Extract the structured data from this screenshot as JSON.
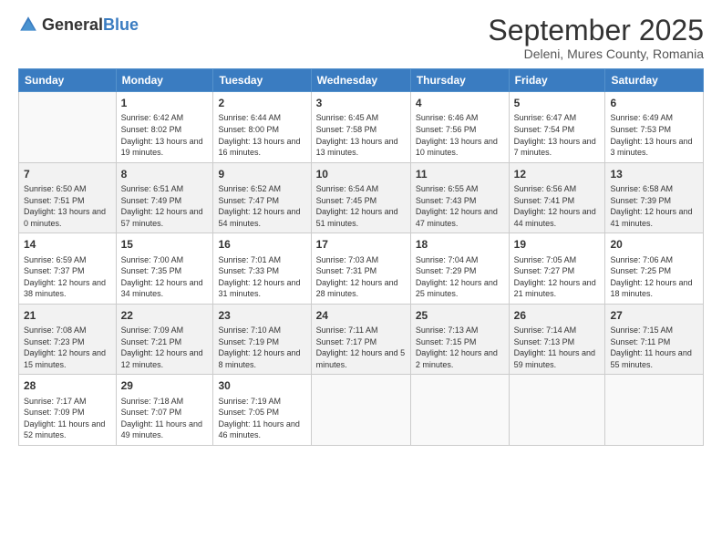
{
  "logo": {
    "general": "General",
    "blue": "Blue"
  },
  "title": "September 2025",
  "subtitle": "Deleni, Mures County, Romania",
  "days_header": [
    "Sunday",
    "Monday",
    "Tuesday",
    "Wednesday",
    "Thursday",
    "Friday",
    "Saturday"
  ],
  "weeks": [
    [
      {
        "day": "",
        "sunrise": "",
        "sunset": "",
        "daylight": ""
      },
      {
        "day": "1",
        "sunrise": "Sunrise: 6:42 AM",
        "sunset": "Sunset: 8:02 PM",
        "daylight": "Daylight: 13 hours and 19 minutes."
      },
      {
        "day": "2",
        "sunrise": "Sunrise: 6:44 AM",
        "sunset": "Sunset: 8:00 PM",
        "daylight": "Daylight: 13 hours and 16 minutes."
      },
      {
        "day": "3",
        "sunrise": "Sunrise: 6:45 AM",
        "sunset": "Sunset: 7:58 PM",
        "daylight": "Daylight: 13 hours and 13 minutes."
      },
      {
        "day": "4",
        "sunrise": "Sunrise: 6:46 AM",
        "sunset": "Sunset: 7:56 PM",
        "daylight": "Daylight: 13 hours and 10 minutes."
      },
      {
        "day": "5",
        "sunrise": "Sunrise: 6:47 AM",
        "sunset": "Sunset: 7:54 PM",
        "daylight": "Daylight: 13 hours and 7 minutes."
      },
      {
        "day": "6",
        "sunrise": "Sunrise: 6:49 AM",
        "sunset": "Sunset: 7:53 PM",
        "daylight": "Daylight: 13 hours and 3 minutes."
      }
    ],
    [
      {
        "day": "7",
        "sunrise": "Sunrise: 6:50 AM",
        "sunset": "Sunset: 7:51 PM",
        "daylight": "Daylight: 13 hours and 0 minutes."
      },
      {
        "day": "8",
        "sunrise": "Sunrise: 6:51 AM",
        "sunset": "Sunset: 7:49 PM",
        "daylight": "Daylight: 12 hours and 57 minutes."
      },
      {
        "day": "9",
        "sunrise": "Sunrise: 6:52 AM",
        "sunset": "Sunset: 7:47 PM",
        "daylight": "Daylight: 12 hours and 54 minutes."
      },
      {
        "day": "10",
        "sunrise": "Sunrise: 6:54 AM",
        "sunset": "Sunset: 7:45 PM",
        "daylight": "Daylight: 12 hours and 51 minutes."
      },
      {
        "day": "11",
        "sunrise": "Sunrise: 6:55 AM",
        "sunset": "Sunset: 7:43 PM",
        "daylight": "Daylight: 12 hours and 47 minutes."
      },
      {
        "day": "12",
        "sunrise": "Sunrise: 6:56 AM",
        "sunset": "Sunset: 7:41 PM",
        "daylight": "Daylight: 12 hours and 44 minutes."
      },
      {
        "day": "13",
        "sunrise": "Sunrise: 6:58 AM",
        "sunset": "Sunset: 7:39 PM",
        "daylight": "Daylight: 12 hours and 41 minutes."
      }
    ],
    [
      {
        "day": "14",
        "sunrise": "Sunrise: 6:59 AM",
        "sunset": "Sunset: 7:37 PM",
        "daylight": "Daylight: 12 hours and 38 minutes."
      },
      {
        "day": "15",
        "sunrise": "Sunrise: 7:00 AM",
        "sunset": "Sunset: 7:35 PM",
        "daylight": "Daylight: 12 hours and 34 minutes."
      },
      {
        "day": "16",
        "sunrise": "Sunrise: 7:01 AM",
        "sunset": "Sunset: 7:33 PM",
        "daylight": "Daylight: 12 hours and 31 minutes."
      },
      {
        "day": "17",
        "sunrise": "Sunrise: 7:03 AM",
        "sunset": "Sunset: 7:31 PM",
        "daylight": "Daylight: 12 hours and 28 minutes."
      },
      {
        "day": "18",
        "sunrise": "Sunrise: 7:04 AM",
        "sunset": "Sunset: 7:29 PM",
        "daylight": "Daylight: 12 hours and 25 minutes."
      },
      {
        "day": "19",
        "sunrise": "Sunrise: 7:05 AM",
        "sunset": "Sunset: 7:27 PM",
        "daylight": "Daylight: 12 hours and 21 minutes."
      },
      {
        "day": "20",
        "sunrise": "Sunrise: 7:06 AM",
        "sunset": "Sunset: 7:25 PM",
        "daylight": "Daylight: 12 hours and 18 minutes."
      }
    ],
    [
      {
        "day": "21",
        "sunrise": "Sunrise: 7:08 AM",
        "sunset": "Sunset: 7:23 PM",
        "daylight": "Daylight: 12 hours and 15 minutes."
      },
      {
        "day": "22",
        "sunrise": "Sunrise: 7:09 AM",
        "sunset": "Sunset: 7:21 PM",
        "daylight": "Daylight: 12 hours and 12 minutes."
      },
      {
        "day": "23",
        "sunrise": "Sunrise: 7:10 AM",
        "sunset": "Sunset: 7:19 PM",
        "daylight": "Daylight: 12 hours and 8 minutes."
      },
      {
        "day": "24",
        "sunrise": "Sunrise: 7:11 AM",
        "sunset": "Sunset: 7:17 PM",
        "daylight": "Daylight: 12 hours and 5 minutes."
      },
      {
        "day": "25",
        "sunrise": "Sunrise: 7:13 AM",
        "sunset": "Sunset: 7:15 PM",
        "daylight": "Daylight: 12 hours and 2 minutes."
      },
      {
        "day": "26",
        "sunrise": "Sunrise: 7:14 AM",
        "sunset": "Sunset: 7:13 PM",
        "daylight": "Daylight: 11 hours and 59 minutes."
      },
      {
        "day": "27",
        "sunrise": "Sunrise: 7:15 AM",
        "sunset": "Sunset: 7:11 PM",
        "daylight": "Daylight: 11 hours and 55 minutes."
      }
    ],
    [
      {
        "day": "28",
        "sunrise": "Sunrise: 7:17 AM",
        "sunset": "Sunset: 7:09 PM",
        "daylight": "Daylight: 11 hours and 52 minutes."
      },
      {
        "day": "29",
        "sunrise": "Sunrise: 7:18 AM",
        "sunset": "Sunset: 7:07 PM",
        "daylight": "Daylight: 11 hours and 49 minutes."
      },
      {
        "day": "30",
        "sunrise": "Sunrise: 7:19 AM",
        "sunset": "Sunset: 7:05 PM",
        "daylight": "Daylight: 11 hours and 46 minutes."
      },
      {
        "day": "",
        "sunrise": "",
        "sunset": "",
        "daylight": ""
      },
      {
        "day": "",
        "sunrise": "",
        "sunset": "",
        "daylight": ""
      },
      {
        "day": "",
        "sunrise": "",
        "sunset": "",
        "daylight": ""
      },
      {
        "day": "",
        "sunrise": "",
        "sunset": "",
        "daylight": ""
      }
    ]
  ]
}
